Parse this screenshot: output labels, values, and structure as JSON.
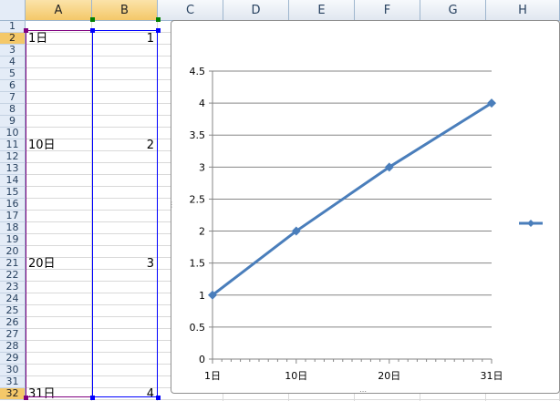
{
  "sheet": {
    "columns": [
      "A",
      "B",
      "C",
      "D",
      "E",
      "F",
      "G",
      "H"
    ],
    "selected_columns": [
      "A",
      "B"
    ],
    "rows": [
      "1",
      "2",
      "3",
      "4",
      "5",
      "6",
      "7",
      "8",
      "9",
      "10",
      "11",
      "12",
      "13",
      "14",
      "15",
      "16",
      "17",
      "18",
      "19",
      "20",
      "21",
      "22",
      "23",
      "24",
      "25",
      "26",
      "27",
      "28",
      "29",
      "30",
      "31",
      "32"
    ],
    "selected_rows": [
      "2",
      "32"
    ],
    "cells": [
      {
        "row": "2",
        "a": "1日",
        "b": "1"
      },
      {
        "row": "11",
        "a": "10日",
        "b": "2"
      },
      {
        "row": "21",
        "a": "20日",
        "b": "3"
      },
      {
        "row": "32",
        "a": "31日",
        "b": "4"
      }
    ]
  },
  "chart_data": {
    "type": "line",
    "x": [
      "1日",
      "10日",
      "20日",
      "31日"
    ],
    "x_positions_days": [
      1,
      10,
      20,
      31
    ],
    "series": [
      {
        "values": [
          1,
          2,
          3,
          4
        ],
        "color": "#4a7ebb",
        "marker": "diamond"
      }
    ],
    "title": "",
    "xlabel": "",
    "ylabel": "",
    "ylim": [
      0,
      4.5
    ],
    "xlim_days": [
      1,
      31
    ],
    "yticks": [
      "0",
      "0.5",
      "1",
      "1.5",
      "2",
      "2.5",
      "3",
      "3.5",
      "4",
      "4.5"
    ],
    "ytick_values": [
      0,
      0.5,
      1,
      1.5,
      2,
      2.5,
      3,
      3.5,
      4,
      4.5
    ],
    "grid": true,
    "legend": "right"
  }
}
